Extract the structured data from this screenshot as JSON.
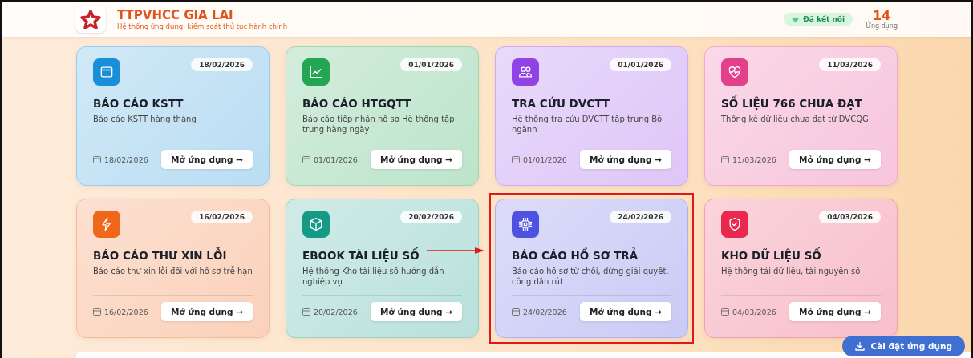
{
  "header": {
    "title": "TTPVHCC GIA LAI",
    "subtitle": "Hệ thống ứng dụng, kiểm soát thủ tục hành chính",
    "status": "Đã kết nối",
    "count": "14",
    "count_label": "Ứng dụng"
  },
  "cards": [
    {
      "kind": "window",
      "color": "#1a8fd8",
      "badge": "18/02/2026",
      "title": "BÁO CÁO KSTT",
      "description": "Báo cáo KSTT hàng tháng",
      "date": "18/02/2026",
      "button": "Mở ứng dụng →",
      "highlighted": false
    },
    {
      "kind": "chart",
      "color": "#22a652",
      "badge": "01/01/2026",
      "title": "BÁO CÁO HTGQTT",
      "description": "Báo cáo tiếp nhận hồ sơ Hệ thống tập trung hàng ngày",
      "date": "01/01/2026",
      "button": "Mở ứng dụng →",
      "highlighted": false
    },
    {
      "kind": "users",
      "color": "#9142e6",
      "badge": "01/01/2026",
      "title": "TRA CỨU DVCTT",
      "description": "Hệ thống tra cứu DVCTT tập trung Bộ ngành",
      "date": "01/01/2026",
      "button": "Mở ứng dụng →",
      "highlighted": false
    },
    {
      "kind": "heart",
      "color": "#e43f8a",
      "badge": "11/03/2026",
      "title": "SỐ LIỆU 766 CHƯA ĐẠT",
      "description": "Thống kê dữ liệu chưa đạt từ DVCQG",
      "date": "11/03/2026",
      "button": "Mở ứng dụng →",
      "highlighted": false
    },
    {
      "kind": "bolt",
      "color": "#f0661a",
      "badge": "16/02/2026",
      "title": "BÁO CÁO THƯ XIN LỖI",
      "description": "Báo cáo thư xin lỗi đối với hồ sơ trễ hạn",
      "date": "16/02/2026",
      "button": "Mở ứng dụng →",
      "highlighted": false
    },
    {
      "kind": "box",
      "color": "#159a86",
      "badge": "20/02/2026",
      "title": "EBOOK TÀI LIỆU SỐ",
      "description": "Hệ thống Kho tài liệu số hướng dẫn nghiệp vụ",
      "date": "20/02/2026",
      "button": "Mở ứng dụng →",
      "highlighted": false
    },
    {
      "kind": "chip",
      "color": "#4f52e0",
      "badge": "24/02/2026",
      "title": "BÁO CÁO HỒ SƠ TRẢ",
      "description": "Báo cáo hồ sơ từ chối, dừng giải quyết, công dân rút",
      "date": "24/02/2026",
      "button": "Mở ứng dụng →",
      "highlighted": true
    },
    {
      "kind": "shield",
      "color": "#e8284f",
      "badge": "04/03/2026",
      "title": "KHO DỮ LIỆU SỐ",
      "description": "Hệ thống tải dữ liệu, tài nguyên số",
      "date": "04/03/2026",
      "button": "Mở ứng dụng →",
      "highlighted": false
    }
  ],
  "install_button": "Cài đặt ứng dụng"
}
